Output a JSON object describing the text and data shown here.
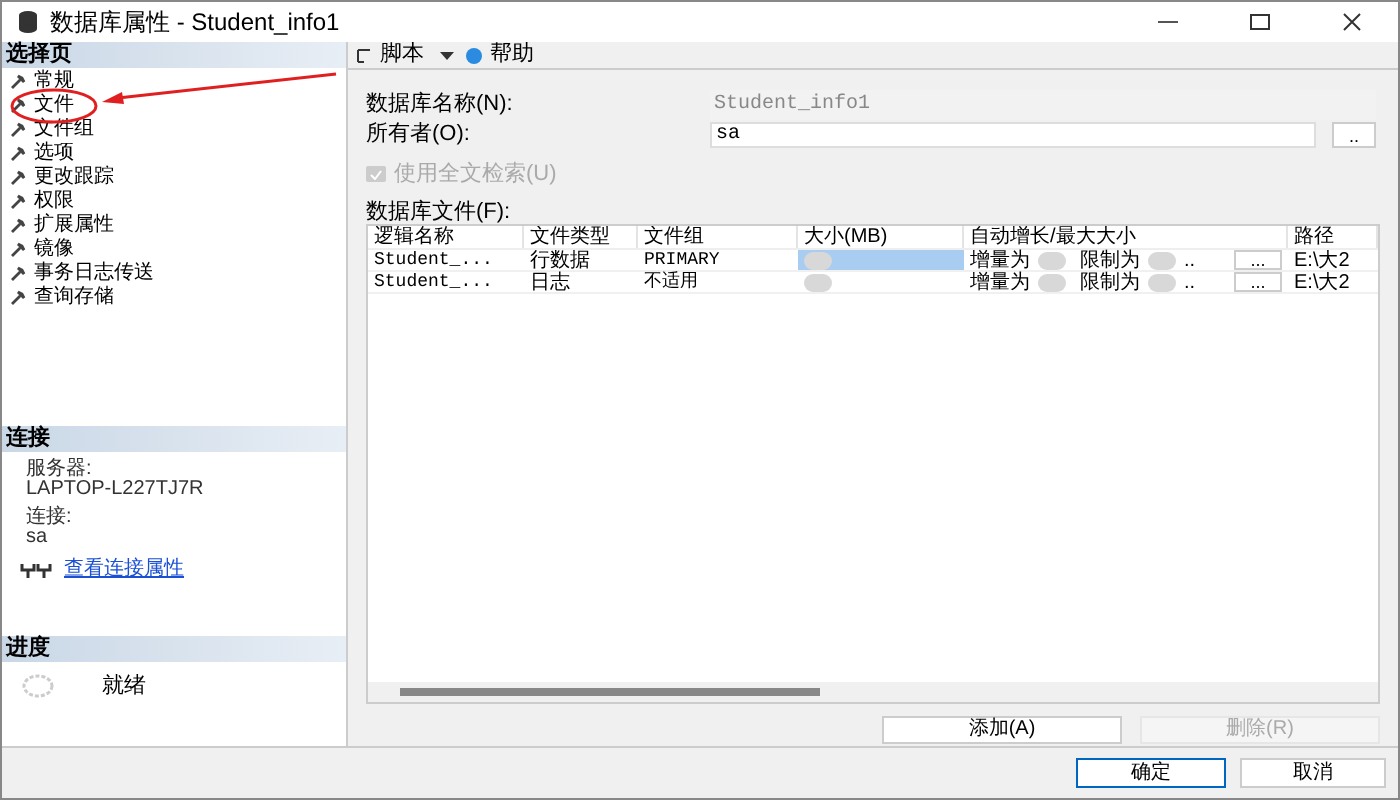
{
  "window": {
    "title": "数据库属性 - Student_info1"
  },
  "sidebar": {
    "header": "选择页",
    "items": [
      {
        "label": "常规",
        "selected": false
      },
      {
        "label": "文件",
        "selected": false
      },
      {
        "label": "文件组",
        "selected": false
      },
      {
        "label": "选项",
        "selected": false
      },
      {
        "label": "更改跟踪",
        "selected": false
      },
      {
        "label": "权限",
        "selected": false
      },
      {
        "label": "扩展属性",
        "selected": false
      },
      {
        "label": "镜像",
        "selected": false
      },
      {
        "label": "事务日志传送",
        "selected": false
      },
      {
        "label": "查询存储",
        "selected": false
      }
    ]
  },
  "connection": {
    "header": "连接",
    "server_label": "服务器:",
    "server": "LAPTOP-L227TJ7R",
    "conn_label": "连接:",
    "conn": "sa",
    "link": "查看连接属性"
  },
  "progress": {
    "header": "进度",
    "status": "就绪"
  },
  "toolbar": {
    "script": "脚本",
    "help": "帮助"
  },
  "form": {
    "name_label": "数据库名称(N):",
    "name_value": "Student_info1",
    "owner_label": "所有者(O):",
    "owner_value": "sa",
    "owner_button": "..",
    "fulltext": {
      "label": "使用全文检索(U)",
      "checked": true,
      "disabled": true
    }
  },
  "files": {
    "label": "数据库文件(F):",
    "columns": [
      "逻辑名称",
      "文件类型",
      "文件组",
      "大小(MB)",
      "自动增长/最大大小",
      "路径"
    ],
    "rows": [
      {
        "name": "Student_...",
        "type": "行数据",
        "group": "PRIMARY",
        "growth": "增量为",
        "limit": "限制为",
        "limit_tail": "..",
        "button": "...",
        "path": "E:\\大2",
        "selected": true
      },
      {
        "name": "Student_...",
        "type": "日志",
        "group": "不适用",
        "growth": "增量为",
        "limit": "限制为",
        "limit_tail": "..",
        "button": "...",
        "path": "E:\\大2",
        "selected": false
      }
    ]
  },
  "buttons": {
    "add": {
      "label": "添加(A)",
      "disabled": false
    },
    "remove": {
      "label": "删除(R)",
      "disabled": true
    },
    "ok": "确定",
    "cancel": "取消"
  }
}
